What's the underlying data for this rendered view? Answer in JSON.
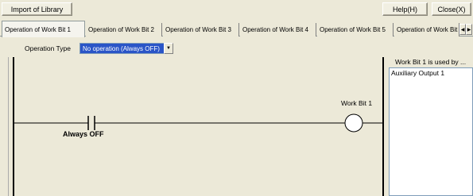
{
  "toolbar": {
    "import_label": "Import of Library",
    "help_label": "Help(H)",
    "close_label": "Close(X)"
  },
  "tabs": [
    {
      "label": "Operation of Work Bit 1",
      "active": true
    },
    {
      "label": "Operation of Work Bit 2",
      "active": false
    },
    {
      "label": "Operation of Work Bit 3",
      "active": false
    },
    {
      "label": "Operation of Work Bit 4",
      "active": false
    },
    {
      "label": "Operation of Work Bit 5",
      "active": false
    },
    {
      "label": "Operation of Work Bit",
      "active": false
    }
  ],
  "tab_scroll": {
    "left_icon": "◀",
    "right_icon": "▶"
  },
  "operation": {
    "label": "Operation Type",
    "selected": "No operation (Always OFF)",
    "dropdown_icon": "▼"
  },
  "ladder": {
    "coil_label": "Work Bit 1",
    "contact_label": "Always OFF"
  },
  "used_by": {
    "title": "Work Bit 1 is used by ...",
    "items": [
      "Auxiliary Output 1"
    ]
  },
  "colors": {
    "selection": "#2a55c7",
    "background": "#ece9d8"
  }
}
